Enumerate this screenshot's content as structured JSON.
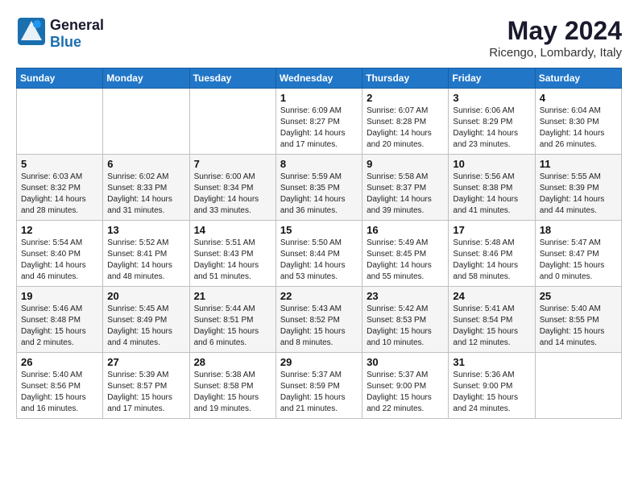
{
  "logo": {
    "line1": "General",
    "line2": "Blue"
  },
  "title": "May 2024",
  "location": "Ricengo, Lombardy, Italy",
  "weekdays": [
    "Sunday",
    "Monday",
    "Tuesday",
    "Wednesday",
    "Thursday",
    "Friday",
    "Saturday"
  ],
  "weeks": [
    [
      {
        "day": "",
        "detail": ""
      },
      {
        "day": "",
        "detail": ""
      },
      {
        "day": "",
        "detail": ""
      },
      {
        "day": "1",
        "detail": "Sunrise: 6:09 AM\nSunset: 8:27 PM\nDaylight: 14 hours\nand 17 minutes."
      },
      {
        "day": "2",
        "detail": "Sunrise: 6:07 AM\nSunset: 8:28 PM\nDaylight: 14 hours\nand 20 minutes."
      },
      {
        "day": "3",
        "detail": "Sunrise: 6:06 AM\nSunset: 8:29 PM\nDaylight: 14 hours\nand 23 minutes."
      },
      {
        "day": "4",
        "detail": "Sunrise: 6:04 AM\nSunset: 8:30 PM\nDaylight: 14 hours\nand 26 minutes."
      }
    ],
    [
      {
        "day": "5",
        "detail": "Sunrise: 6:03 AM\nSunset: 8:32 PM\nDaylight: 14 hours\nand 28 minutes."
      },
      {
        "day": "6",
        "detail": "Sunrise: 6:02 AM\nSunset: 8:33 PM\nDaylight: 14 hours\nand 31 minutes."
      },
      {
        "day": "7",
        "detail": "Sunrise: 6:00 AM\nSunset: 8:34 PM\nDaylight: 14 hours\nand 33 minutes."
      },
      {
        "day": "8",
        "detail": "Sunrise: 5:59 AM\nSunset: 8:35 PM\nDaylight: 14 hours\nand 36 minutes."
      },
      {
        "day": "9",
        "detail": "Sunrise: 5:58 AM\nSunset: 8:37 PM\nDaylight: 14 hours\nand 39 minutes."
      },
      {
        "day": "10",
        "detail": "Sunrise: 5:56 AM\nSunset: 8:38 PM\nDaylight: 14 hours\nand 41 minutes."
      },
      {
        "day": "11",
        "detail": "Sunrise: 5:55 AM\nSunset: 8:39 PM\nDaylight: 14 hours\nand 44 minutes."
      }
    ],
    [
      {
        "day": "12",
        "detail": "Sunrise: 5:54 AM\nSunset: 8:40 PM\nDaylight: 14 hours\nand 46 minutes."
      },
      {
        "day": "13",
        "detail": "Sunrise: 5:52 AM\nSunset: 8:41 PM\nDaylight: 14 hours\nand 48 minutes."
      },
      {
        "day": "14",
        "detail": "Sunrise: 5:51 AM\nSunset: 8:43 PM\nDaylight: 14 hours\nand 51 minutes."
      },
      {
        "day": "15",
        "detail": "Sunrise: 5:50 AM\nSunset: 8:44 PM\nDaylight: 14 hours\nand 53 minutes."
      },
      {
        "day": "16",
        "detail": "Sunrise: 5:49 AM\nSunset: 8:45 PM\nDaylight: 14 hours\nand 55 minutes."
      },
      {
        "day": "17",
        "detail": "Sunrise: 5:48 AM\nSunset: 8:46 PM\nDaylight: 14 hours\nand 58 minutes."
      },
      {
        "day": "18",
        "detail": "Sunrise: 5:47 AM\nSunset: 8:47 PM\nDaylight: 15 hours\nand 0 minutes."
      }
    ],
    [
      {
        "day": "19",
        "detail": "Sunrise: 5:46 AM\nSunset: 8:48 PM\nDaylight: 15 hours\nand 2 minutes."
      },
      {
        "day": "20",
        "detail": "Sunrise: 5:45 AM\nSunset: 8:49 PM\nDaylight: 15 hours\nand 4 minutes."
      },
      {
        "day": "21",
        "detail": "Sunrise: 5:44 AM\nSunset: 8:51 PM\nDaylight: 15 hours\nand 6 minutes."
      },
      {
        "day": "22",
        "detail": "Sunrise: 5:43 AM\nSunset: 8:52 PM\nDaylight: 15 hours\nand 8 minutes."
      },
      {
        "day": "23",
        "detail": "Sunrise: 5:42 AM\nSunset: 8:53 PM\nDaylight: 15 hours\nand 10 minutes."
      },
      {
        "day": "24",
        "detail": "Sunrise: 5:41 AM\nSunset: 8:54 PM\nDaylight: 15 hours\nand 12 minutes."
      },
      {
        "day": "25",
        "detail": "Sunrise: 5:40 AM\nSunset: 8:55 PM\nDaylight: 15 hours\nand 14 minutes."
      }
    ],
    [
      {
        "day": "26",
        "detail": "Sunrise: 5:40 AM\nSunset: 8:56 PM\nDaylight: 15 hours\nand 16 minutes."
      },
      {
        "day": "27",
        "detail": "Sunrise: 5:39 AM\nSunset: 8:57 PM\nDaylight: 15 hours\nand 17 minutes."
      },
      {
        "day": "28",
        "detail": "Sunrise: 5:38 AM\nSunset: 8:58 PM\nDaylight: 15 hours\nand 19 minutes."
      },
      {
        "day": "29",
        "detail": "Sunrise: 5:37 AM\nSunset: 8:59 PM\nDaylight: 15 hours\nand 21 minutes."
      },
      {
        "day": "30",
        "detail": "Sunrise: 5:37 AM\nSunset: 9:00 PM\nDaylight: 15 hours\nand 22 minutes."
      },
      {
        "day": "31",
        "detail": "Sunrise: 5:36 AM\nSunset: 9:00 PM\nDaylight: 15 hours\nand 24 minutes."
      },
      {
        "day": "",
        "detail": ""
      }
    ]
  ]
}
